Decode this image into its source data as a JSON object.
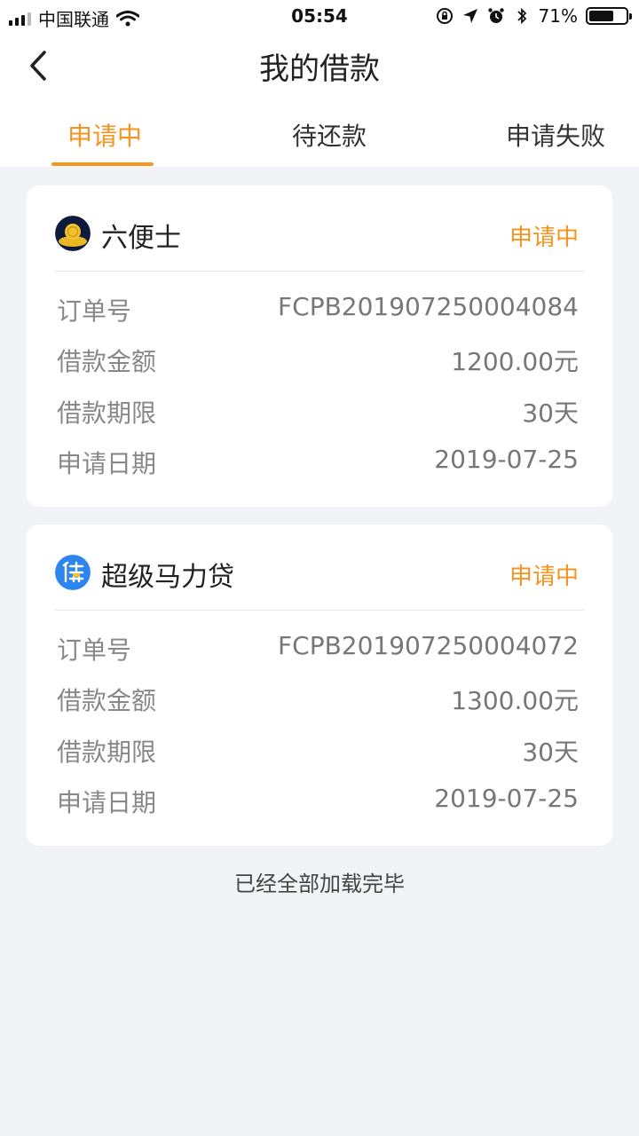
{
  "statusbar": {
    "carrier": "中国联通",
    "time": "05:54",
    "battery_text": "71%",
    "battery_level": 0.71
  },
  "navbar": {
    "title": "我的借款"
  },
  "tabs": [
    {
      "label": "申请中",
      "active": true
    },
    {
      "label": "待还款",
      "active": false
    },
    {
      "label": "申请失败",
      "active": false
    }
  ],
  "loans": [
    {
      "company": "六便士",
      "status": "申请中",
      "logo_icon": "coin-icon",
      "rows": [
        {
          "label": "订单号",
          "value": "FCPB201907250004084"
        },
        {
          "label": "借款金额",
          "value": "1200.00元"
        },
        {
          "label": "借款期限",
          "value": "30天"
        },
        {
          "label": "申请日期",
          "value": "2019-07-25"
        }
      ]
    },
    {
      "company": "超级马力贷",
      "status": "申请中",
      "logo_icon": "dai-logo-icon",
      "rows": [
        {
          "label": "订单号",
          "value": "FCPB201907250004072"
        },
        {
          "label": "借款金额",
          "value": "1300.00元"
        },
        {
          "label": "借款期限",
          "value": "30天"
        },
        {
          "label": "申请日期",
          "value": "2019-07-25"
        }
      ]
    }
  ],
  "footer": {
    "text": "已经全部加载完毕"
  },
  "colors": {
    "accent": "#f7931e",
    "background": "#f2f3f7"
  }
}
